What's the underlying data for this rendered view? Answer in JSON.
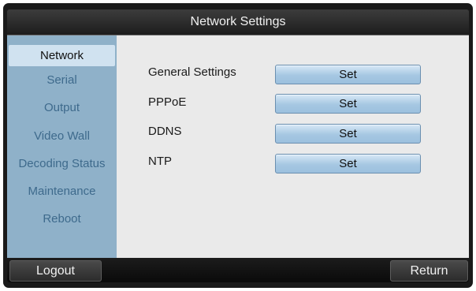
{
  "window": {
    "title": "Network Settings"
  },
  "sidebar": {
    "items": [
      {
        "label": "Network"
      },
      {
        "label": "Serial"
      },
      {
        "label": "Output"
      },
      {
        "label": "Video Wall"
      },
      {
        "label": "Decoding Status"
      },
      {
        "label": "Maintenance"
      },
      {
        "label": "Reboot"
      }
    ],
    "active": "Network"
  },
  "main": {
    "rows": [
      {
        "label": "General Settings",
        "button": "Set"
      },
      {
        "label": "PPPoE",
        "button": "Set"
      },
      {
        "label": "DDNS",
        "button": "Set"
      },
      {
        "label": "NTP",
        "button": "Set"
      }
    ]
  },
  "footer": {
    "logout_label": "Logout",
    "return_label": "Return"
  },
  "colors": {
    "sidebar": "#8fb1c9",
    "active_item": "#d0e2f0",
    "button": "#a6c7e2",
    "titlebar": "#2b2b2b"
  }
}
